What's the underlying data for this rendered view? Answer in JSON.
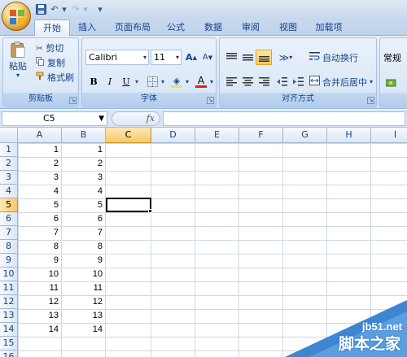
{
  "quick_access": {
    "undo_symbol": "↶",
    "redo_symbol": "↷",
    "dropdown_symbol": "▾"
  },
  "tabs": [
    {
      "label": "开始",
      "active": true
    },
    {
      "label": "插入"
    },
    {
      "label": "页面布局"
    },
    {
      "label": "公式"
    },
    {
      "label": "数据"
    },
    {
      "label": "审阅"
    },
    {
      "label": "视图"
    },
    {
      "label": "加载项"
    }
  ],
  "clipboard": {
    "paste": "粘贴",
    "cut": "剪切",
    "copy": "复制",
    "format_painter": "格式刷",
    "group": "剪贴板"
  },
  "font": {
    "name": "Calibri",
    "size": "11",
    "bold": "B",
    "italic": "I",
    "underline": "U",
    "grow": "A",
    "shrink": "A",
    "font_color": "A",
    "group": "字体",
    "fill_color": "#f5e050",
    "text_color": "#e0201a"
  },
  "alignment": {
    "wrap_text": "自动换行",
    "merge_center": "合并后居中",
    "group": "对齐方式"
  },
  "number": {
    "format": "常规"
  },
  "formula_bar": {
    "name_box": "C5",
    "fx": "fx",
    "formula": ""
  },
  "columns": [
    "A",
    "B",
    "C",
    "D",
    "E",
    "F",
    "G",
    "H",
    "I"
  ],
  "rows": [
    "1",
    "2",
    "3",
    "4",
    "5",
    "6",
    "7",
    "8",
    "9",
    "10",
    "11",
    "12",
    "13",
    "14",
    "15",
    "16"
  ],
  "cells": {
    "A": [
      "1",
      "2",
      "3",
      "4",
      "5",
      "6",
      "7",
      "8",
      "9",
      "10",
      "11",
      "12",
      "13",
      "14"
    ],
    "B": [
      "1",
      "2",
      "3",
      "4",
      "5",
      "6",
      "7",
      "8",
      "9",
      "10",
      "11",
      "12",
      "13",
      "14"
    ]
  },
  "selected_cell": "C5",
  "watermark": {
    "line1": "jb51.net",
    "line2": "脚本之家"
  }
}
